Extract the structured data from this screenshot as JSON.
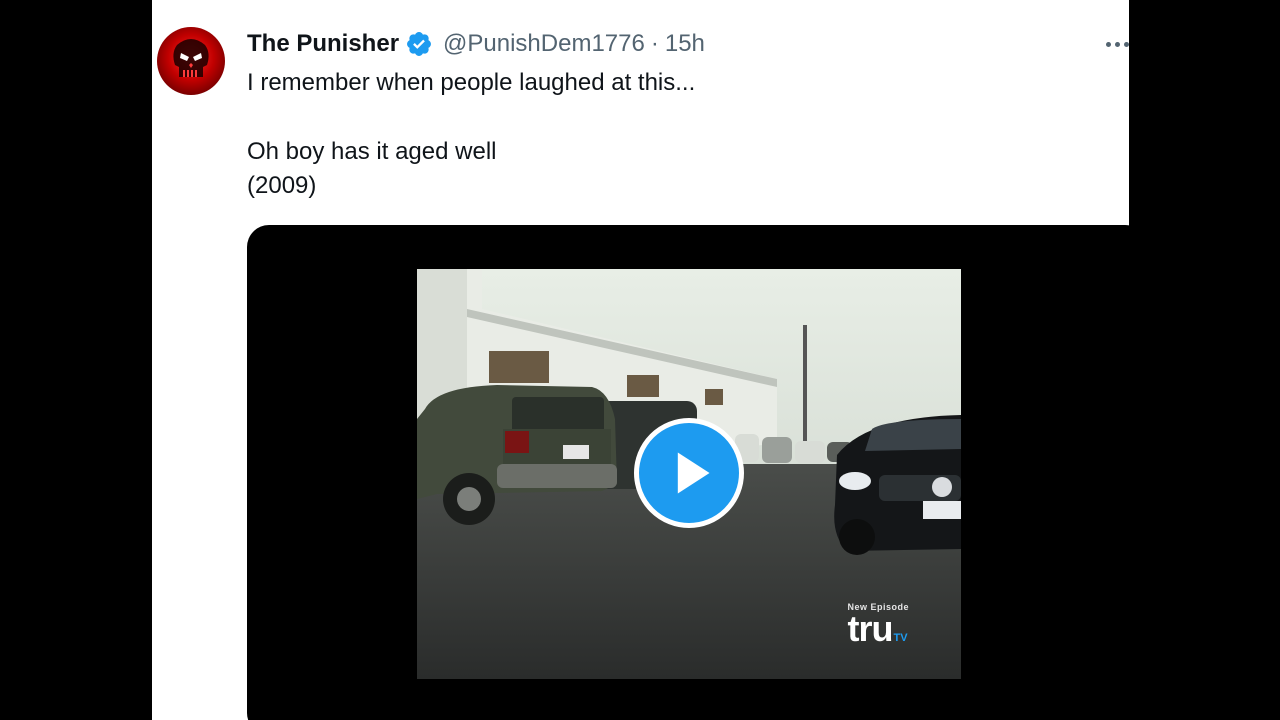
{
  "tweet": {
    "author_name": "The Punisher",
    "handle": "@PunishDem1776",
    "separator": "·",
    "time": "15h",
    "text_lines": [
      "I remember when people laughed at this...",
      "Oh boy has it aged well",
      "(2009)"
    ]
  },
  "media": {
    "watermark_top": "New Episode",
    "watermark_logo": "tru",
    "watermark_sub": "TV"
  },
  "colors": {
    "accent": "#1d9bf0",
    "text": "#0f1419",
    "secondary": "#536471"
  },
  "icons": {
    "verified": "verified-badge-icon",
    "more": "more-options-icon",
    "play": "play-icon"
  }
}
